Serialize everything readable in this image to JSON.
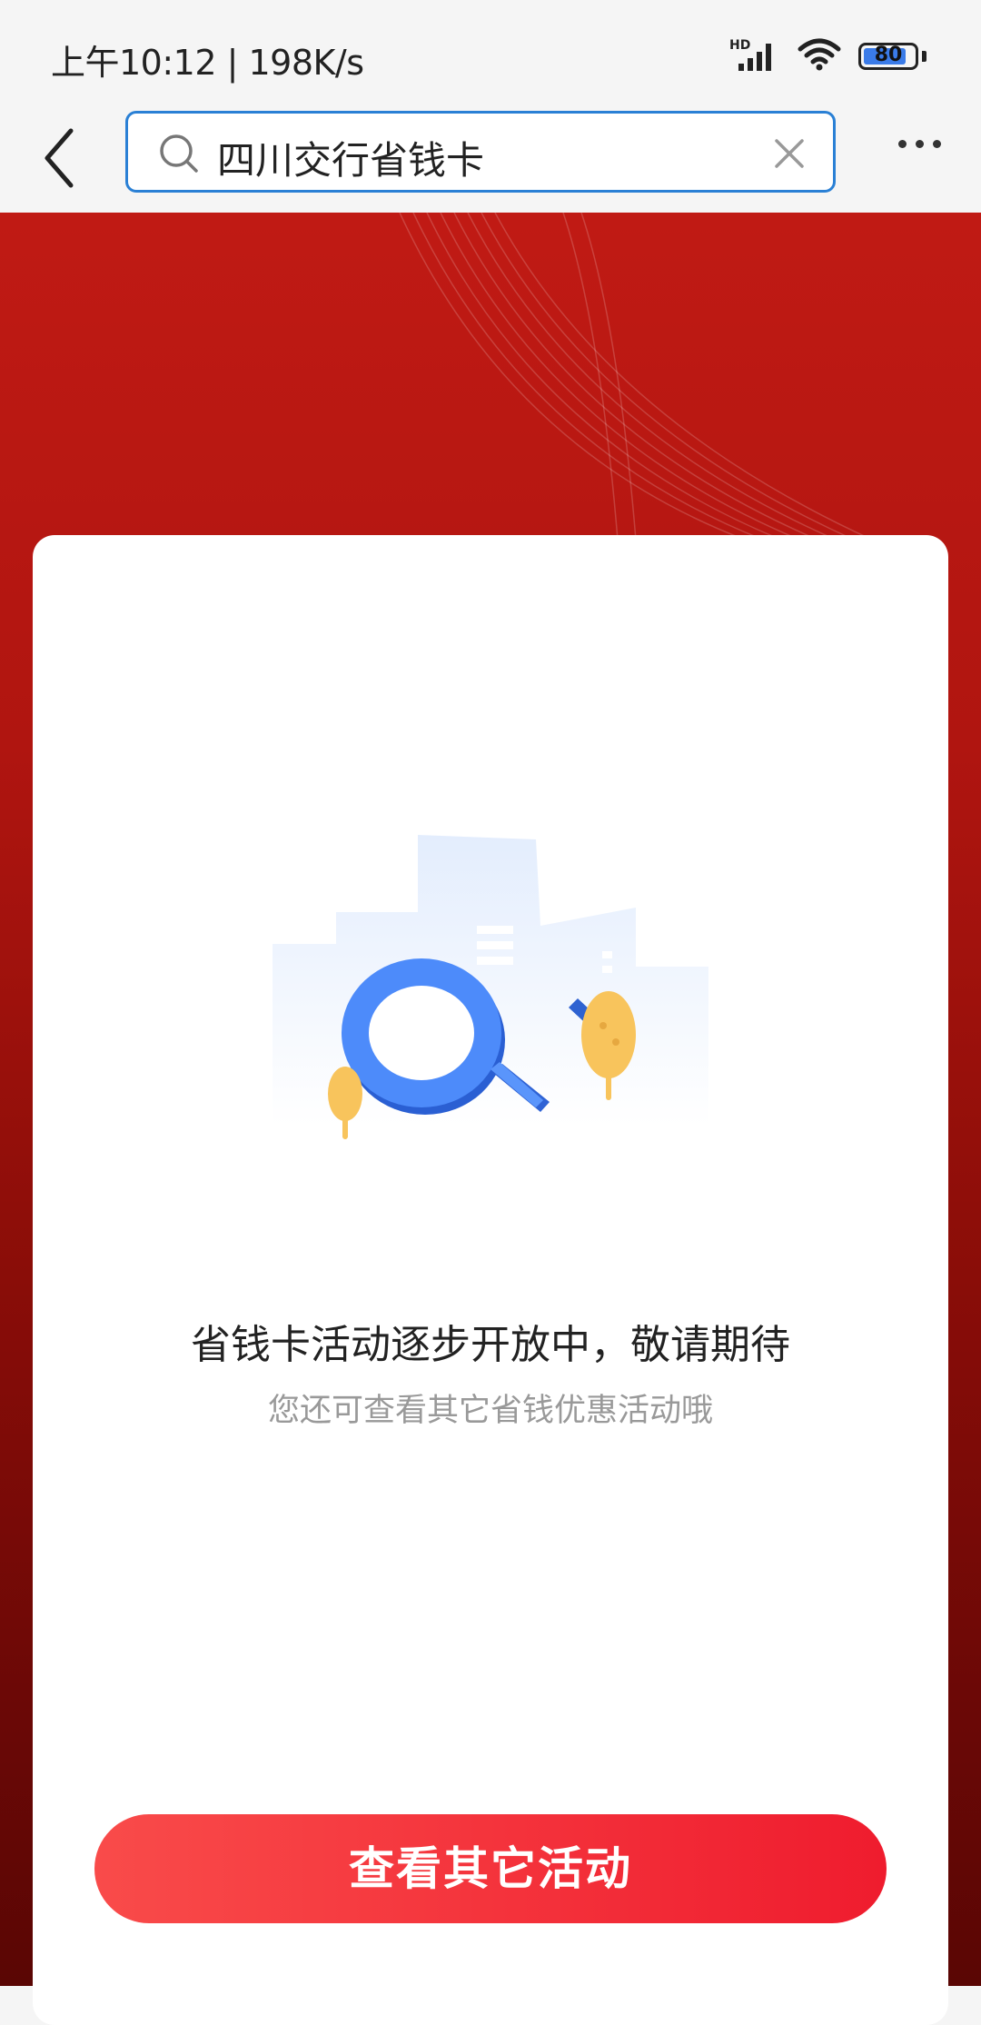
{
  "status_bar": {
    "time_speed": "上午10:12 | 198K/s",
    "signal_label": "HD",
    "battery_level": "80",
    "icons": [
      "hd-signal-icon",
      "wifi-icon",
      "battery-icon"
    ]
  },
  "search": {
    "query": "四川交行省钱卡",
    "icons": [
      "search-icon",
      "clear-icon"
    ]
  },
  "main": {
    "title": "省钱卡活动逐步开放中，敬请期待",
    "subtitle": "您还可查看其它省钱优惠活动哦",
    "cta_label": "查看其它活动"
  },
  "colors": {
    "accent_blue": "#2a80d5",
    "banner_red": "#c01a14",
    "cta_red": "#ef1c2e"
  }
}
